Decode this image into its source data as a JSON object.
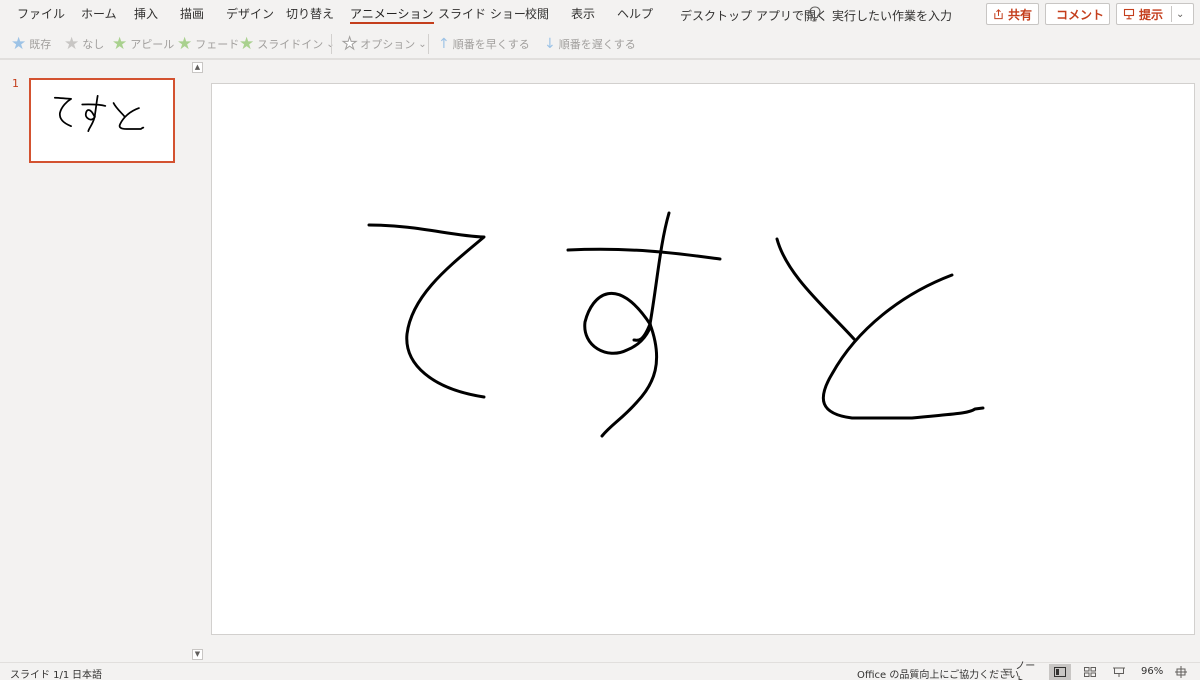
{
  "menu": {
    "tabs": [
      {
        "label": "ファイル"
      },
      {
        "label": "ホーム"
      },
      {
        "label": "挿入"
      },
      {
        "label": "描画"
      },
      {
        "label": "デザイン"
      },
      {
        "label": "切り替え"
      },
      {
        "label": "アニメーション"
      },
      {
        "label": "スライド ショー"
      },
      {
        "label": "校閲"
      },
      {
        "label": "表示"
      },
      {
        "label": "ヘルプ"
      }
    ],
    "active_tab": "アニメーション",
    "open_desktop_app": "デスクトップ アプリで開く",
    "tell_me": "実行したい作業を入力",
    "share_label": "共有",
    "comment_label": "コメント",
    "present_label": "提示"
  },
  "toolbar": {
    "effects": [
      {
        "label": "既存",
        "icon": "star-icon",
        "color": "#9dc3e6"
      },
      {
        "label": "なし",
        "icon": "star-icon",
        "color": "#c8c6c4"
      },
      {
        "label": "アピール",
        "icon": "star-icon",
        "color": "#a9d18e"
      },
      {
        "label": "フェード",
        "icon": "star-icon",
        "color": "#a9d18e"
      },
      {
        "label": "スライドイン",
        "icon": "star-icon",
        "color": "#a9d18e"
      }
    ],
    "options_label": "オプション",
    "move_earlier": "順番を早くする",
    "move_later": "順番を遅くする"
  },
  "thumbnails": [
    {
      "number": "1"
    }
  ],
  "status": {
    "slide_info": "スライド 1/1",
    "language": "日本語",
    "feedback": "Office の品質向上にご協力ください",
    "notes": "ノート",
    "zoom": "96%"
  },
  "colors": {
    "accent": "#c43e1c",
    "thumbnail_border": "#d35230",
    "ink": "#000000"
  }
}
